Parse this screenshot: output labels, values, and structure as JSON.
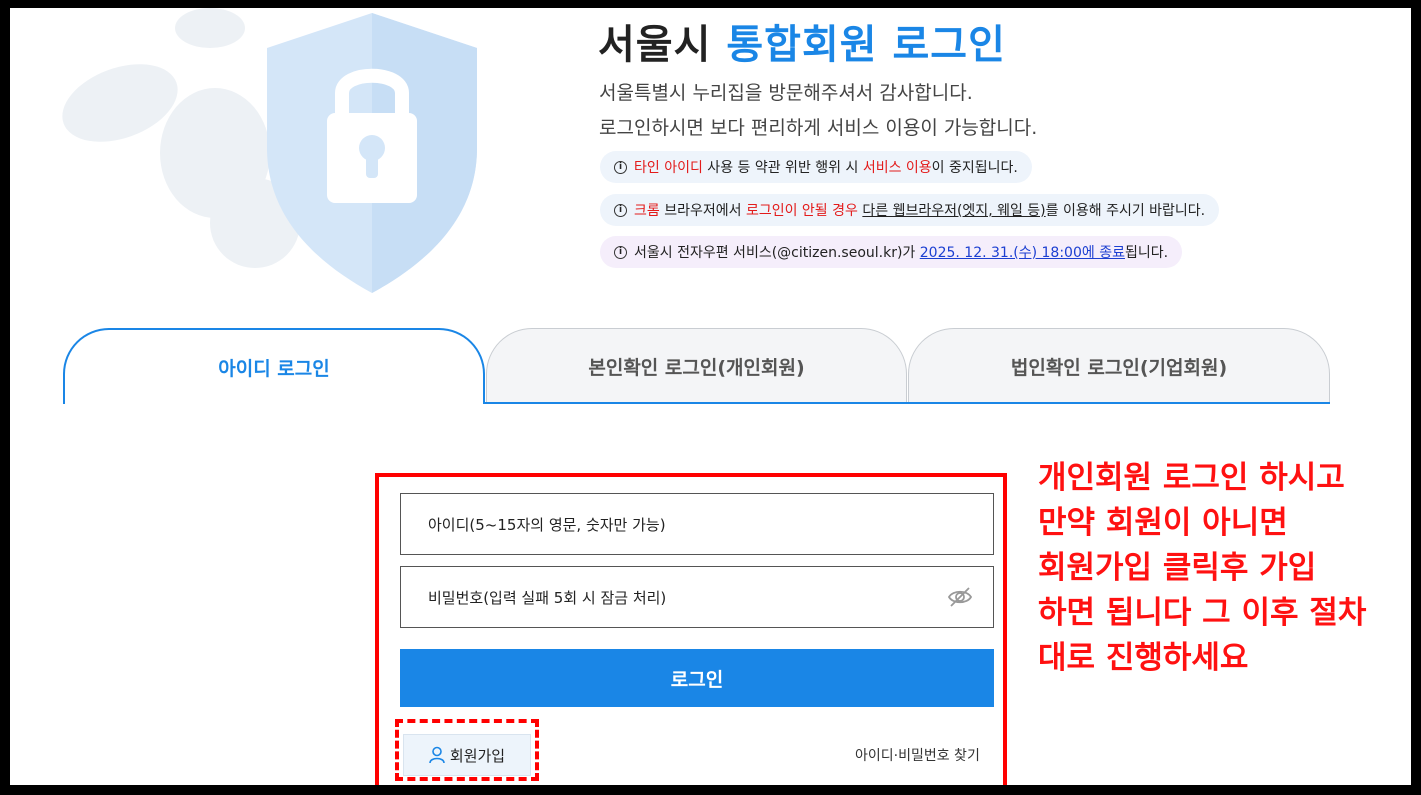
{
  "header": {
    "title_prefix": "서울시",
    "title_accent": "통합회원 로그인",
    "greeting_line1": "서울특별시 누리집을 방문해주셔서 감사합니다.",
    "greeting_line2": "로그인하시면 보다 편리하게 서비스 이용이 가능합니다."
  },
  "notices": [
    {
      "icon": "info-icon",
      "parts": [
        "타인 아이디",
        " 사용 등 약관 위반 행위 시 ",
        "서비스 이용",
        "이 중지됩니다."
      ]
    },
    {
      "icon": "info-icon",
      "parts": [
        "크롬",
        " 브라우저에서 ",
        "로그인이 안될 경우",
        " ",
        "다른 웹브라우저(엣지, 웨일 등)",
        "를 이용해 주시기 바랍니다."
      ]
    },
    {
      "icon": "info-icon",
      "parts": [
        "서울시 전자우편 서비스(@citizen.seoul.kr)가 ",
        "2025. 12. 31.(수) 18:00에 종료",
        "됩니다."
      ]
    }
  ],
  "tabs": [
    {
      "label": "아이디 로그인",
      "active": true
    },
    {
      "label": "본인확인 로그인(개인회원)",
      "active": false
    },
    {
      "label": "법인확인 로그인(기업회원)",
      "active": false
    }
  ],
  "form": {
    "id_placeholder": "아이디(5~15자의 영문, 숫자만 가능)",
    "password_placeholder": "비밀번호(입력 실패 5회 시 잠금 처리)",
    "login_button": "로그인",
    "join_button": "회원가입",
    "find_link": "아이디·비밀번호 찾기"
  },
  "annotation": {
    "lines": [
      "개인회원 로그인 하시고",
      "만약 회원이 아니면",
      "회원가입 클릭후 가입",
      "하면 됩니다 그 이후 절차",
      "대로 진행하세요"
    ]
  },
  "colors": {
    "accent": "#1a86e6",
    "highlight_red": "#ff0000",
    "notice_blue_bg": "#eef4fb",
    "notice_purple_bg": "#f5eefb"
  }
}
